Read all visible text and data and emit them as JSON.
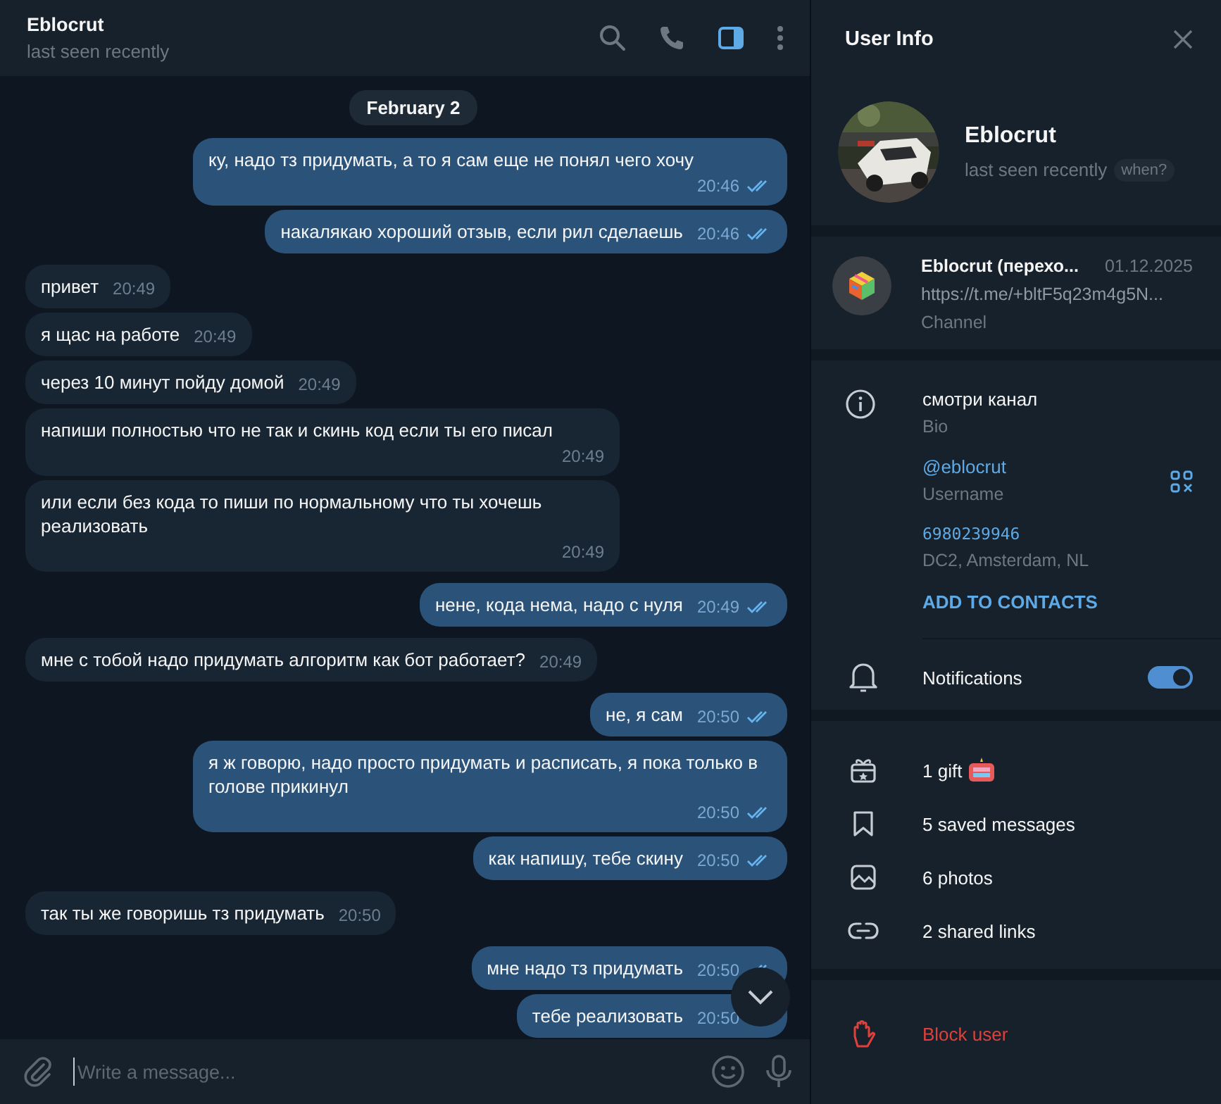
{
  "chat_header": {
    "name": "Eblocrut",
    "status": "last seen recently"
  },
  "date_pill": "February 2",
  "messages": [
    {
      "text": "ку, надо тз придумать, а то я сам еще не понял чего хочу",
      "time": "20:46",
      "outgoing": true
    },
    {
      "text": "накалякаю хороший отзыв, если рил сделаешь",
      "time": "20:46",
      "outgoing": true
    },
    {
      "text": "привет",
      "time": "20:49",
      "outgoing": false
    },
    {
      "text": "я щас на работе",
      "time": "20:49",
      "outgoing": false
    },
    {
      "text": "через 10 минут пойду домой",
      "time": "20:49",
      "outgoing": false
    },
    {
      "text": "напиши полностью что не так и скинь код если ты его писал",
      "time": "20:49",
      "outgoing": false
    },
    {
      "text": "или если без кода то пиши по нормальному что ты хочешь реализовать",
      "time": "20:49",
      "outgoing": false
    },
    {
      "text": "нене, кода нема, надо с нуля",
      "time": "20:49",
      "outgoing": true
    },
    {
      "text": "мне с тобой надо придумать алгоритм как бот работает?",
      "time": "20:49",
      "outgoing": false
    },
    {
      "text": "не, я сам",
      "time": "20:50",
      "outgoing": true
    },
    {
      "text": "я ж говорю, надо просто придумать и расписать, я пока только в голове прикинул",
      "time": "20:50",
      "outgoing": true
    },
    {
      "text": "как напишу, тебе скину",
      "time": "20:50",
      "outgoing": true
    },
    {
      "text": "так ты же говоришь тз придумать",
      "time": "20:50",
      "outgoing": false
    },
    {
      "text": "мне надо тз придумать",
      "time": "20:50",
      "outgoing": true
    },
    {
      "text": "тебе реализовать",
      "time": "20:50",
      "outgoing": true
    }
  ],
  "composer": {
    "placeholder": "Write a message..."
  },
  "info": {
    "title": "User Info",
    "name": "Eblocrut",
    "status": "last seen recently",
    "when_badge": "when?",
    "channel": {
      "name": "Eblocrut (перехо...",
      "date": "01.12.2025",
      "link": "https://t.me/+bltF5q23m4g5N...",
      "type": "Channel"
    },
    "details": [
      {
        "kind": "bio",
        "value": "смотри канал",
        "label": "Bio"
      },
      {
        "kind": "username",
        "value": "@eblocrut",
        "label": "Username"
      },
      {
        "kind": "id",
        "value": "6980239946",
        "label": "DC2, Amsterdam, NL"
      }
    ],
    "add_contacts": "ADD TO CONTACTS",
    "notifications": {
      "label": "Notifications",
      "on": true
    },
    "media": [
      {
        "kind": "gift",
        "label": "1 gift"
      },
      {
        "kind": "saved",
        "label": "5 saved messages"
      },
      {
        "kind": "photos",
        "label": "6 photos"
      },
      {
        "kind": "links",
        "label": "2 shared links"
      }
    ],
    "block": "Block user"
  }
}
